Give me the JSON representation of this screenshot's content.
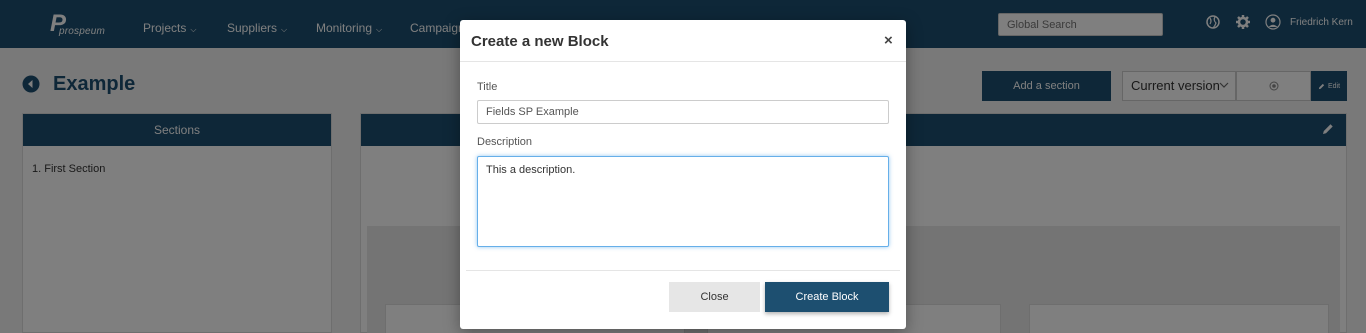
{
  "nav": {
    "logo_text": "prospeum",
    "items": [
      {
        "label": "Projects"
      },
      {
        "label": "Suppliers"
      },
      {
        "label": "Monitoring"
      },
      {
        "label": "Campaign"
      }
    ],
    "search_placeholder": "Global Search",
    "icons": [
      "globe-icon",
      "gear-icon",
      "user-icon"
    ],
    "user_name": "Friedrich Kern"
  },
  "page": {
    "title": "Example",
    "add_section_label": "Add a section",
    "version_selected": "Current version",
    "edit_label": "Edit"
  },
  "sections": {
    "header": "Sections",
    "items": [
      "1. First Section"
    ]
  },
  "modal": {
    "title": "Create a new Block",
    "close_symbol": "×",
    "title_label": "Title",
    "title_value": "Fields SP Example",
    "description_label": "Description",
    "description_value": "This a description.",
    "close_button": "Close",
    "create_button": "Create Block"
  },
  "colors": {
    "brand": "#1d4f70",
    "background": "#f3f3f3",
    "focus": "#66afe9"
  }
}
